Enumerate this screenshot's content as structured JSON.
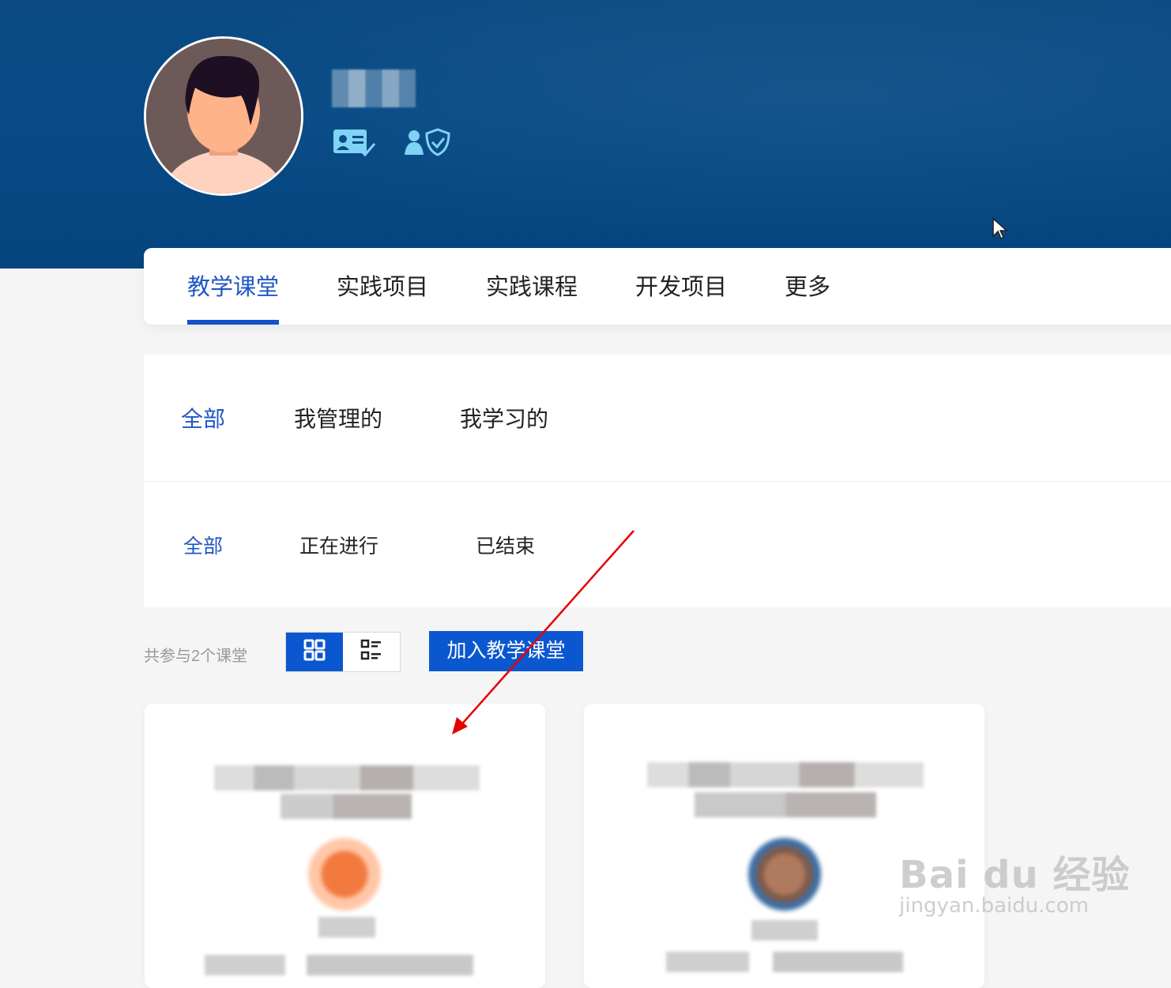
{
  "header": {
    "icons": [
      "id-card-check-icon",
      "user-shield-icon"
    ]
  },
  "main_tabs": [
    {
      "label": "教学课堂",
      "active": true
    },
    {
      "label": "实践项目",
      "active": false
    },
    {
      "label": "实践课程",
      "active": false
    },
    {
      "label": "开发项目",
      "active": false
    },
    {
      "label": "更多",
      "active": false
    }
  ],
  "role_filters": [
    {
      "label": "全部",
      "active": true
    },
    {
      "label": "我管理的",
      "active": false
    },
    {
      "label": "我学习的",
      "active": false
    }
  ],
  "status_filters": [
    {
      "label": "全部",
      "active": true
    },
    {
      "label": "正在进行",
      "active": false
    },
    {
      "label": "已结束",
      "active": false
    }
  ],
  "toolbar": {
    "count_text": "共参与2个课堂",
    "view_modes": [
      "grid-view-icon",
      "list-view-icon"
    ],
    "active_view": "grid",
    "join_label": "加入教学课堂"
  },
  "watermark": {
    "main": "Bai du 经验",
    "sub": "jingyan.baidu.com"
  },
  "colors": {
    "brand_blue": "#0b57d0",
    "hero_blue": "#074a86",
    "active_text": "#1f57c3",
    "arrow_red": "#e60000"
  }
}
